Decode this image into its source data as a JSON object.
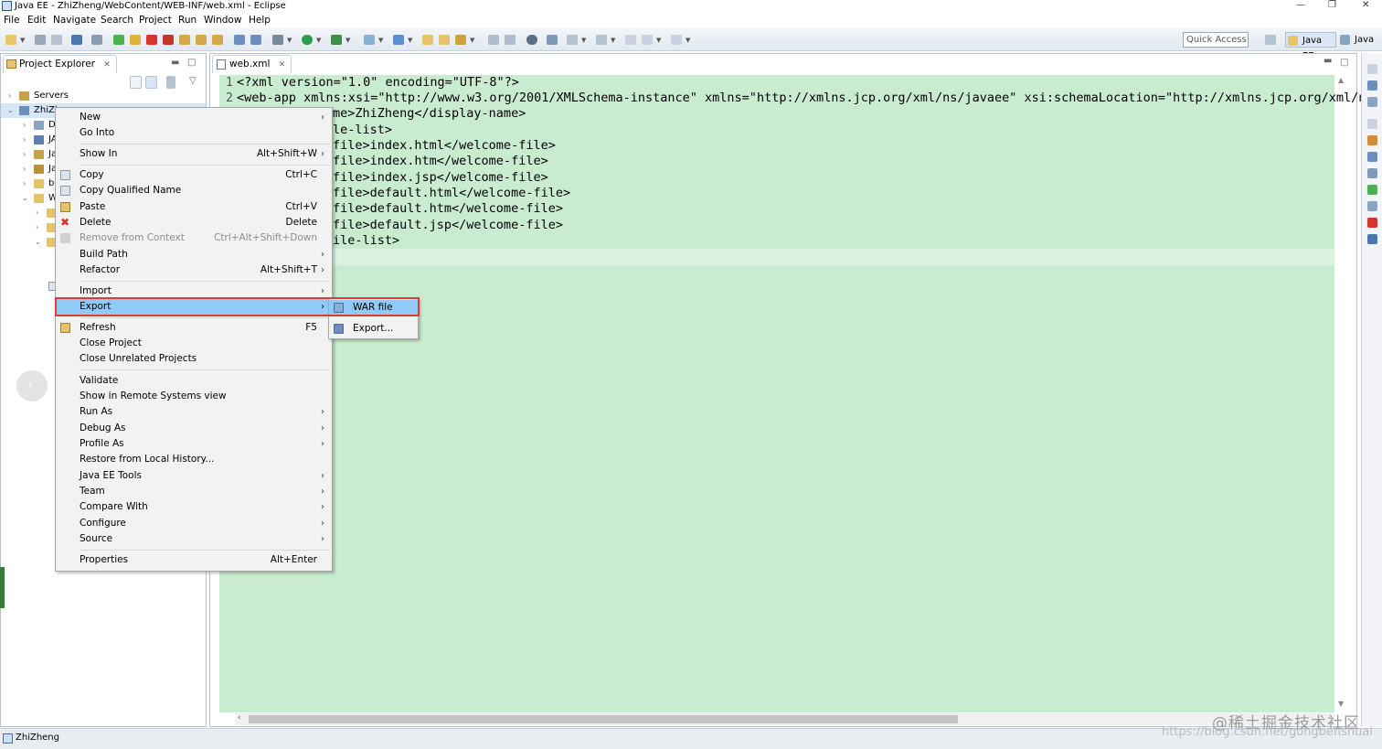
{
  "window": {
    "title": "Java EE - ZhiZheng/WebContent/WEB-INF/web.xml - Eclipse",
    "controls": [
      "—",
      "❐",
      "✕"
    ]
  },
  "menubar": [
    "File",
    "Edit",
    "Navigate",
    "Search",
    "Project",
    "Run",
    "Window",
    "Help"
  ],
  "toolbar": {
    "quick_access_placeholder": "Quick Access",
    "perspectives": [
      "Java EE",
      "Java"
    ]
  },
  "explorer": {
    "tab_label": "Project Explorer",
    "tab_close": "✕",
    "items": [
      {
        "label": "Servers"
      },
      {
        "label": "ZhiZh"
      },
      {
        "label": "D"
      },
      {
        "label": "JA"
      },
      {
        "label": "Ja"
      },
      {
        "label": "Ja"
      },
      {
        "label": "bu"
      },
      {
        "label": "W"
      }
    ]
  },
  "editor": {
    "tab_label": "web.xml",
    "tab_close": "✕",
    "line_numbers": [
      "1",
      "2"
    ],
    "lines": [
      "<?xml version=\"1.0\" encoding=\"UTF-8\"?>",
      "<web-app xmlns:xsi=\"http://www.w3.org/2001/XMLSchema-instance\" xmlns=\"http://xmlns.jcp.org/xml/ns/javaee\" xsi:schemaLocation=\"http://xmlns.jcp.org/xml/ns/",
      "me>ZhiZheng</display-name>",
      "le-list>",
      "file>index.html</welcome-file>",
      "file>index.htm</welcome-file>",
      "file>index.jsp</welcome-file>",
      "file>default.html</welcome-file>",
      "file>default.htm</welcome-file>",
      "file>default.jsp</welcome-file>",
      "ile-list>"
    ]
  },
  "context_menu": {
    "items": [
      {
        "label": "New",
        "shortcut": "",
        "submenu": true
      },
      {
        "label": "Go Into",
        "shortcut": "",
        "submenu": false
      },
      {
        "label": "Show In",
        "shortcut": "Alt+Shift+W",
        "submenu": true
      },
      {
        "label": "Copy",
        "shortcut": "Ctrl+C",
        "submenu": false
      },
      {
        "label": "Copy Qualified Name",
        "shortcut": "",
        "submenu": false
      },
      {
        "label": "Paste",
        "shortcut": "Ctrl+V",
        "submenu": false
      },
      {
        "label": "Delete",
        "shortcut": "Delete",
        "submenu": false
      },
      {
        "label": "Remove from Context",
        "shortcut": "Ctrl+Alt+Shift+Down",
        "submenu": false,
        "disabled": true
      },
      {
        "label": "Build Path",
        "shortcut": "",
        "submenu": true
      },
      {
        "label": "Refactor",
        "shortcut": "Alt+Shift+T",
        "submenu": true
      },
      {
        "label": "Import",
        "shortcut": "",
        "submenu": true
      },
      {
        "label": "Export",
        "shortcut": "",
        "submenu": true,
        "highlighted": true
      },
      {
        "label": "Refresh",
        "shortcut": "F5",
        "submenu": false
      },
      {
        "label": "Close Project",
        "shortcut": "",
        "submenu": false
      },
      {
        "label": "Close Unrelated Projects",
        "shortcut": "",
        "submenu": false
      },
      {
        "label": "Validate",
        "shortcut": "",
        "submenu": false
      },
      {
        "label": "Show in Remote Systems view",
        "shortcut": "",
        "submenu": false
      },
      {
        "label": "Run As",
        "shortcut": "",
        "submenu": true
      },
      {
        "label": "Debug As",
        "shortcut": "",
        "submenu": true
      },
      {
        "label": "Profile As",
        "shortcut": "",
        "submenu": true
      },
      {
        "label": "Restore from Local History...",
        "shortcut": "",
        "submenu": false
      },
      {
        "label": "Java EE Tools",
        "shortcut": "",
        "submenu": true
      },
      {
        "label": "Team",
        "shortcut": "",
        "submenu": true
      },
      {
        "label": "Compare With",
        "shortcut": "",
        "submenu": true
      },
      {
        "label": "Configure",
        "shortcut": "",
        "submenu": true
      },
      {
        "label": "Source",
        "shortcut": "",
        "submenu": true
      },
      {
        "label": "Properties",
        "shortcut": "Alt+Enter",
        "submenu": false
      }
    ],
    "submenu_arrow": "›"
  },
  "export_submenu": {
    "items": [
      {
        "label": "WAR file",
        "highlighted": true
      },
      {
        "label": "Export..."
      }
    ]
  },
  "statusbar": {
    "text": "ZhiZheng"
  },
  "watermark": {
    "line1": "@稀土掘金技术社区",
    "line2": "https://blog.csdn.net/gongbenshuai"
  },
  "colors": {
    "editor_bg": "#c9ecd0",
    "menu_highlight": "#91c9f7",
    "annotation_box": "#e53935"
  }
}
